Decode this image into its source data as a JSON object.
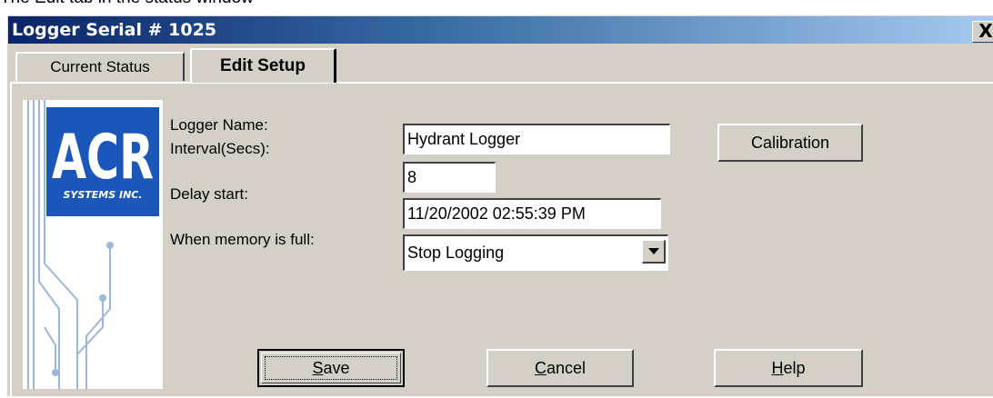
{
  "caption": "The Edit tab in the status window",
  "window": {
    "title": "Logger Serial # 1025",
    "close_label": "X"
  },
  "tabs": [
    {
      "label": "Current Status",
      "selected": false
    },
    {
      "label": "Edit Setup",
      "selected": true
    }
  ],
  "logo": {
    "text": "ACR",
    "subtext": "SYSTEMS INC."
  },
  "form": {
    "logger_name_label": "Logger Name:",
    "logger_name_value": "Hydrant Logger",
    "interval_label": "Interval(Secs):",
    "interval_value": "8",
    "delay_label": "Delay start:",
    "delay_value": "11/20/2002 02:55:39 PM",
    "memory_label": "When memory is full:",
    "memory_value": "Stop Logging"
  },
  "buttons": {
    "calibration": "Calibration",
    "save_mnemonic": "S",
    "save_rest": "ave",
    "cancel_mnemonic": "C",
    "cancel_rest": "ancel",
    "help_mnemonic": "H",
    "help_rest": "elp"
  },
  "colors": {
    "title_start": "#0a246a",
    "title_end": "#a6caf0",
    "logo_blue": "#1a57b8",
    "dialog_bg": "#d4d0c8"
  }
}
